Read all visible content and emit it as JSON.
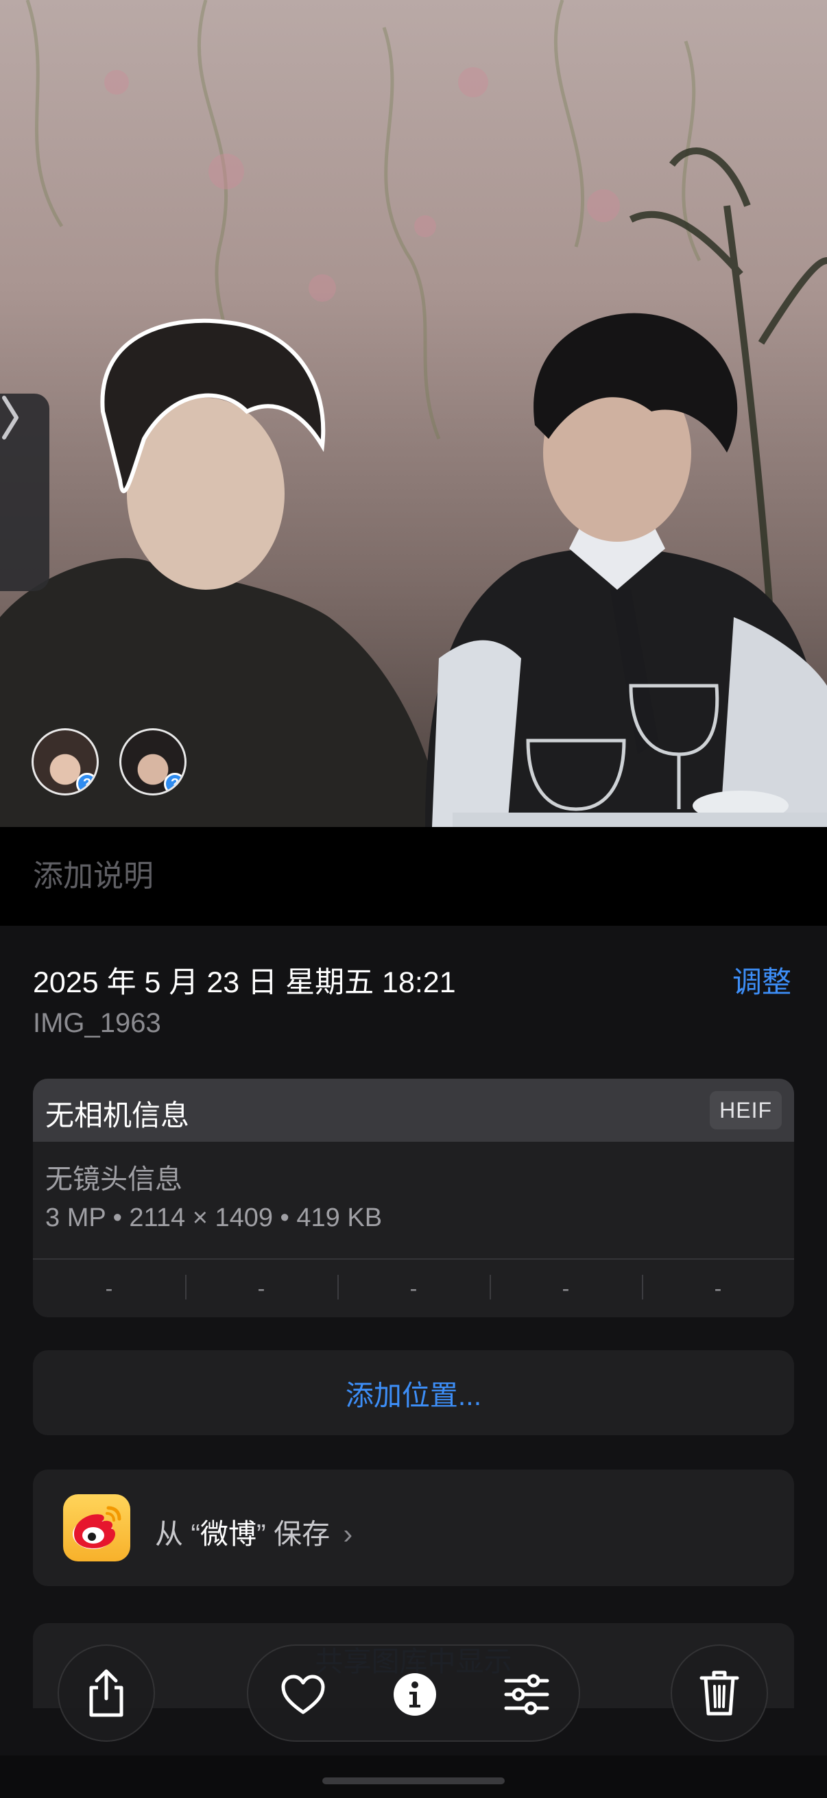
{
  "photo": {
    "people": [
      {
        "name": "person-1",
        "badge": "?"
      },
      {
        "name": "person-2",
        "badge": "?"
      }
    ]
  },
  "caption": {
    "placeholder": "添加说明"
  },
  "info": {
    "datetime": "2025 年 5 月 23 日  星期五 18:21",
    "adjust_label": "调整",
    "filename": "IMG_1963",
    "camera": {
      "title": "无相机信息",
      "format_badge": "HEIF",
      "lens": "无镜头信息",
      "specs": "3 MP • 2114 × 1409 • 419 KB",
      "exif": [
        "-",
        "-",
        "-",
        "-",
        "-"
      ]
    },
    "location_button": "添加位置...",
    "source": {
      "prefix": "从 “",
      "app": "微博",
      "suffix": "” 保存",
      "chevron": "›"
    },
    "shared_library": "共享图库中显示"
  },
  "toolbar": {
    "share_icon": "share-icon",
    "favorite_icon": "heart-icon",
    "info_icon": "info-icon",
    "edit_icon": "sliders-icon",
    "delete_icon": "trash-icon"
  },
  "colors": {
    "accent": "#3d8ef7",
    "background": "#121214",
    "card": "#1f1f21"
  }
}
